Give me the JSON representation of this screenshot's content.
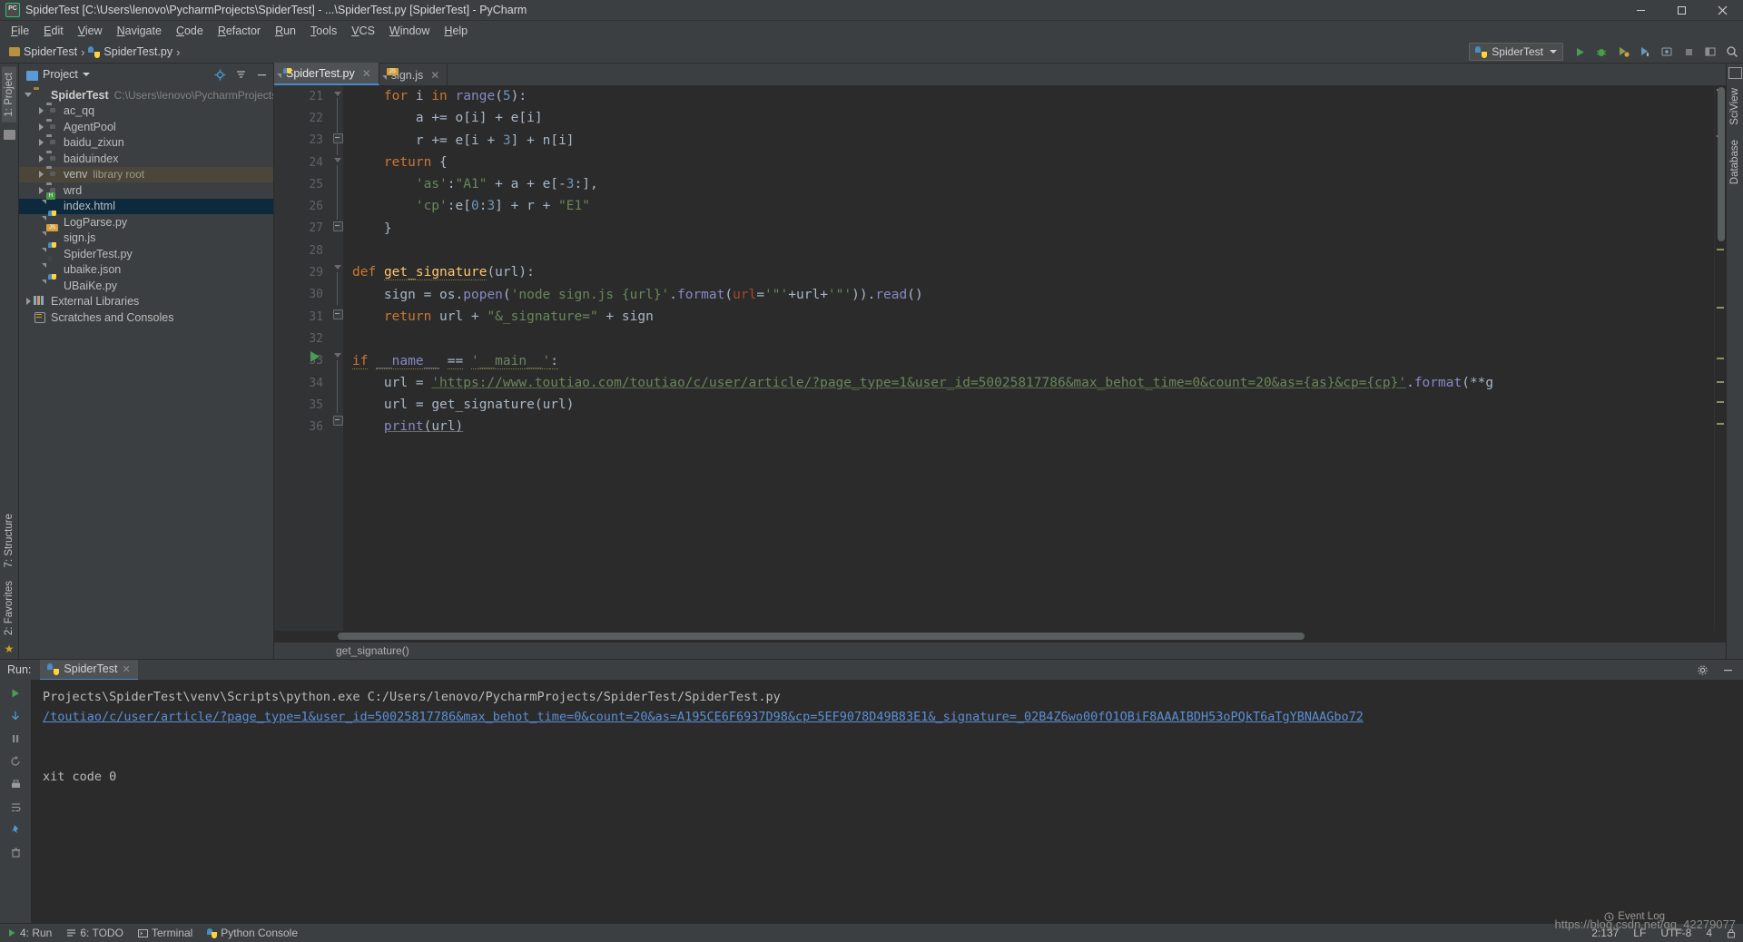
{
  "window": {
    "title": "SpiderTest [C:\\Users\\lenovo\\PycharmProjects\\SpiderTest] - ...\\SpiderTest.py [SpiderTest] - PyCharm",
    "app_icon": "pycharm-icon",
    "minimize": "–",
    "maximize": "❐",
    "close": "✕"
  },
  "menubar": {
    "items": [
      {
        "label": "File"
      },
      {
        "label": "Edit"
      },
      {
        "label": "View"
      },
      {
        "label": "Navigate"
      },
      {
        "label": "Code"
      },
      {
        "label": "Refactor"
      },
      {
        "label": "Run"
      },
      {
        "label": "Tools"
      },
      {
        "label": "VCS"
      },
      {
        "label": "Window"
      },
      {
        "label": "Help"
      }
    ]
  },
  "breadcrumb": {
    "project": "SpiderTest",
    "file": "SpiderTest.py"
  },
  "run_config": {
    "name": "SpiderTest",
    "icon": "python-icon"
  },
  "toolbar_icons": [
    "run-icon",
    "debug-icon",
    "coverage-icon",
    "profile-icon",
    "attach-icon",
    "stop-icon",
    "layout-icon",
    "search-icon"
  ],
  "left_rail": {
    "project_tab": "1: Project",
    "structure_tab": "7: Structure",
    "favorites_tab": "2: Favorites"
  },
  "right_rail": {
    "sciview_tab": "SciView",
    "database_tab": "Database"
  },
  "project_panel": {
    "title": "Project",
    "locate_icon": "locate-icon",
    "collapse_icon": "collapse-all-icon",
    "tree": [
      {
        "label": "SpiderTest",
        "sub": "C:\\Users\\lenovo\\PycharmProjects\\Spider",
        "icon": "folder-root",
        "depth": 0,
        "arrow": "down",
        "bold": true,
        "state": "normal"
      },
      {
        "label": "ac_qq",
        "sub": "",
        "icon": "folder-module",
        "depth": 1,
        "arrow": "right",
        "bold": false,
        "state": "normal"
      },
      {
        "label": "AgentPool",
        "sub": "",
        "icon": "folder-module",
        "depth": 1,
        "arrow": "right",
        "bold": false,
        "state": "normal"
      },
      {
        "label": "baidu_zixun",
        "sub": "",
        "icon": "folder-module",
        "depth": 1,
        "arrow": "right",
        "bold": false,
        "state": "normal"
      },
      {
        "label": "baiduindex",
        "sub": "",
        "icon": "folder-module",
        "depth": 1,
        "arrow": "right",
        "bold": false,
        "state": "normal"
      },
      {
        "label": "venv",
        "sub": "library root",
        "icon": "folder-module",
        "depth": 1,
        "arrow": "right",
        "bold": false,
        "state": "highlight"
      },
      {
        "label": "wrd",
        "sub": "",
        "icon": "folder-module",
        "depth": 1,
        "arrow": "right",
        "bold": false,
        "state": "normal"
      },
      {
        "label": "index.html",
        "sub": "",
        "icon": "html-file",
        "depth": 1,
        "arrow": "none",
        "bold": false,
        "state": "selected"
      },
      {
        "label": "LogParse.py",
        "sub": "",
        "icon": "python-file",
        "depth": 1,
        "arrow": "none",
        "bold": false,
        "state": "normal"
      },
      {
        "label": "sign.js",
        "sub": "",
        "icon": "js-file",
        "depth": 1,
        "arrow": "none",
        "bold": false,
        "state": "normal"
      },
      {
        "label": "SpiderTest.py",
        "sub": "",
        "icon": "python-file",
        "depth": 1,
        "arrow": "none",
        "bold": false,
        "state": "normal"
      },
      {
        "label": "ubaike.json",
        "sub": "",
        "icon": "json-file",
        "depth": 1,
        "arrow": "none",
        "bold": false,
        "state": "normal"
      },
      {
        "label": "UBaiKe.py",
        "sub": "",
        "icon": "python-file",
        "depth": 1,
        "arrow": "none",
        "bold": false,
        "state": "normal"
      },
      {
        "label": "External Libraries",
        "sub": "",
        "icon": "library-icon",
        "depth": 0,
        "arrow": "right",
        "bold": false,
        "state": "normal"
      },
      {
        "label": "Scratches and Consoles",
        "sub": "",
        "icon": "scratch-icon",
        "depth": 0,
        "arrow": "none",
        "bold": false,
        "state": "normal"
      }
    ]
  },
  "editor": {
    "tabs": [
      {
        "label": "SpiderTest.py",
        "icon": "python-file",
        "active": true,
        "close": "✕"
      },
      {
        "label": "sign.js",
        "icon": "js-file",
        "active": false,
        "close": "✕"
      }
    ],
    "first_line": 21,
    "lines": [
      {
        "n": 21,
        "text": "    for i in range(5):"
      },
      {
        "n": 22,
        "text": "        a += o[i] + e[i]"
      },
      {
        "n": 23,
        "text": "        r += e[i + 3] + n[i]"
      },
      {
        "n": 24,
        "text": "    return {"
      },
      {
        "n": 25,
        "text": "        'as':\"A1\" + a + e[-3:],"
      },
      {
        "n": 26,
        "text": "        'cp':e[0:3] + r + \"E1\""
      },
      {
        "n": 27,
        "text": "    }"
      },
      {
        "n": 28,
        "text": ""
      },
      {
        "n": 29,
        "text": "def get_signature(url):"
      },
      {
        "n": 30,
        "text": "    sign = os.popen('node sign.js {url}'.format(url='\"'+url+'\"')).read()"
      },
      {
        "n": 31,
        "text": "    return url + \"&_signature=\" + sign"
      },
      {
        "n": 32,
        "text": ""
      },
      {
        "n": 33,
        "text": "if __name__ == '__main__':"
      },
      {
        "n": 34,
        "text": "    url = 'https://www.toutiao.com/toutiao/c/user/article/?page_type=1&user_id=50025817786&max_behot_time=0&count=20&as={as}&cp={cp}'.format(**g"
      },
      {
        "n": 35,
        "text": "    url = get_signature(url)"
      },
      {
        "n": 36,
        "text": "    print(url)"
      }
    ],
    "status_breadcrumb": "get_signature()"
  },
  "run_panel": {
    "label": "Run:",
    "tab": "SpiderTest",
    "tab_close": "✕",
    "side_icons": [
      "run-icon",
      "scroll-down-icon",
      "pause-icon",
      "rerun-icon",
      "print-icon",
      "soft-wrap-icon",
      "pin-icon",
      "trash-icon"
    ],
    "settings_icon": "gear-icon",
    "minimize_icon": "minimize-icon",
    "console_lines": [
      {
        "text": "Projects\\SpiderTest\\venv\\Scripts\\python.exe C:/Users/lenovo/PycharmProjects/SpiderTest/SpiderTest.py",
        "link": false
      },
      {
        "text": "/toutiao/c/user/article/?page_type=1&user_id=50025817786&max_behot_time=0&count=20&as=A195CE6F6937D98&cp=5EF9078D49B83E1&_signature=_02B4Z6wo00fO1OBiF8AAAIBDH53oPQkT6aTgYBNAAGbo72",
        "link": true
      },
      {
        "text": "",
        "link": false
      },
      {
        "text": "xit code 0",
        "link": false
      }
    ]
  },
  "statusbar": {
    "items": [
      {
        "label": "4: Run",
        "icon": "run-icon"
      },
      {
        "label": "6: TODO",
        "icon": "todo-icon"
      },
      {
        "label": "Terminal",
        "icon": "terminal-icon"
      },
      {
        "label": "Python Console",
        "icon": "python-icon"
      }
    ],
    "event_log": "Event Log",
    "caret": "2:137",
    "line_sep": "LF",
    "encoding": "UTF-8",
    "indent": "4"
  },
  "watermark": "https://blog.csdn.net/qq_42279077"
}
